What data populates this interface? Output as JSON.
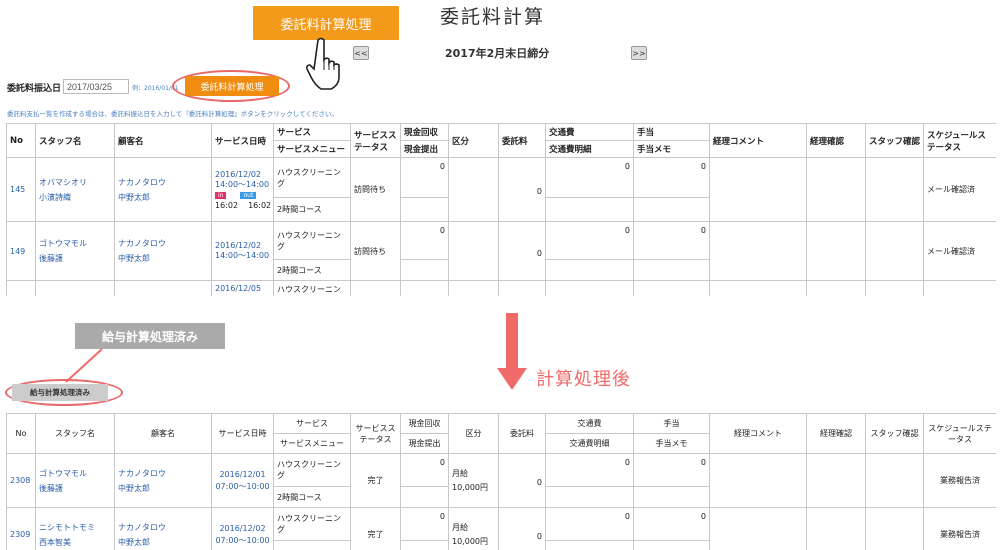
{
  "header": {
    "title": "委託料計算",
    "callout_label": "委託料計算処理",
    "prev_label": "<<",
    "next_label": ">>",
    "period": "2017年2月末日締分"
  },
  "controls": {
    "date_label": "委託料振込日",
    "date_value": "2017/03/25",
    "date_example": "例：2016/01/01",
    "process_button": "委託料計算処理",
    "instruction": "委託料支払一覧を作成する場合は、委託料振込日を入力して『委託料計算処理』ボタンをクリックしてください。"
  },
  "top_table": {
    "headers": {
      "no": "No",
      "staff": "スタッフ名",
      "customer": "顧客名",
      "datetime": "サービス日時",
      "service": "サービス",
      "service_menu": "サービスメニュー",
      "service_status": "サービスステータス",
      "cash_collect": "現金回収",
      "cash_submit": "現金提出",
      "category": "区分",
      "fee": "委託料",
      "transport": "交通費",
      "transport_detail": "交通費明細",
      "allowance": "手当",
      "allowance_memo": "手当メモ",
      "accounting_comment": "経理コメント",
      "accounting_check": "経理確認",
      "staff_check": "スタッフ確認",
      "schedule_status": "スケジュールステータス"
    },
    "rows": [
      {
        "no": "145",
        "staff_kana": "オバマシオリ",
        "staff": "小濱詩織",
        "customer_kana": "ナカノタロウ",
        "customer": "中野太郎",
        "date": "2016/12/02",
        "time": "14:00〜14:00",
        "in": "in",
        "out": "out",
        "actual_in": "16:02",
        "actual_out": "16:02",
        "service": "ハウスクリーニング",
        "menu": "2時間コース",
        "status": "訪問待ち",
        "cash": "0",
        "fee": "0",
        "transport": "0",
        "allowance": "0",
        "schedule": "メール確認済"
      },
      {
        "no": "149",
        "staff_kana": "ゴトウマモル",
        "staff": "後藤護",
        "customer_kana": "ナカノタロウ",
        "customer": "中野太郎",
        "date": "2016/12/02",
        "time": "14:00〜14:00",
        "service": "ハウスクリーニング",
        "menu": "2時間コース",
        "status": "訪問待ち",
        "cash": "0",
        "fee": "0",
        "transport": "0",
        "allowance": "0",
        "schedule": "メール確認済"
      },
      {
        "date": "2016/12/05",
        "service": "ハウスクリーニン"
      }
    ]
  },
  "transition": {
    "gray_callout": "給与計算処理済み",
    "gray_button": "給与計算処理済み",
    "after_label": "計算処理後"
  },
  "bottom_table": {
    "headers": {
      "no": "No",
      "staff": "スタッフ名",
      "customer": "顧客名",
      "datetime": "サービス日時",
      "service": "サービス",
      "service_menu": "サービスメニュー",
      "service_status": "サービスステータス",
      "cash_collect": "現金回収",
      "cash_submit": "現金提出",
      "category": "区分",
      "fee": "委託料",
      "transport": "交通費",
      "transport_detail": "交通費明細",
      "allowance": "手当",
      "allowance_memo": "手当メモ",
      "accounting_comment": "経理コメント",
      "accounting_check": "経理確認",
      "staff_check": "スタッフ確認",
      "schedule_status": "スケジュールステータス"
    },
    "rows": [
      {
        "no": "2308",
        "staff_kana": "ゴトウマモル",
        "staff": "後藤護",
        "customer_kana": "ナカノタロウ",
        "customer": "中野太郎",
        "date": "2016/12/01",
        "time": "07:00〜10:00",
        "service": "ハウスクリーニング",
        "menu": "2時間コース",
        "status": "完了",
        "cash": "0",
        "category": "月給",
        "category_amount": "10,000円",
        "fee": "0",
        "transport": "0",
        "allowance": "0",
        "schedule": "業務報告済"
      },
      {
        "no": "2309",
        "staff_kana": "ニシモトトモミ",
        "staff": "西本智美",
        "customer_kana": "ナカノタロウ",
        "customer": "中野太郎",
        "date": "2016/12/02",
        "time": "07:00〜10:00",
        "service": "ハウスクリーニング",
        "status": "完了",
        "cash": "0",
        "category": "月給",
        "category_amount": "10,000円",
        "fee": "0",
        "transport": "0",
        "allowance": "0",
        "schedule": "業務報告済"
      }
    ]
  },
  "colors": {
    "orange": "#f39a1a",
    "red_accent": "#f06a6a",
    "link_blue": "#2a5ea8",
    "in_badge": "#e2306c",
    "out_badge": "#3a9be0"
  }
}
